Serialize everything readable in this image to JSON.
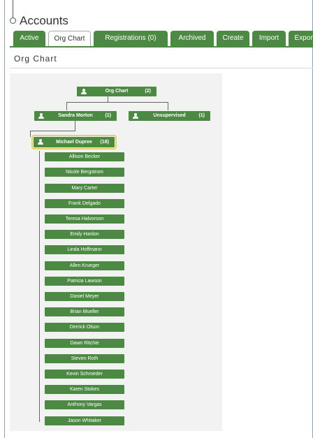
{
  "header": {
    "title": "Accounts"
  },
  "tabs": [
    {
      "label": "Active",
      "active": false
    },
    {
      "label": "Org Chart",
      "active": true
    },
    {
      "label": "Registrations (0)",
      "active": false
    },
    {
      "label": "Archived",
      "active": false
    },
    {
      "label": "Create",
      "active": false
    },
    {
      "label": "Import",
      "active": false
    },
    {
      "label": "Export",
      "active": false
    }
  ],
  "section": {
    "title": "Org Chart"
  },
  "org": {
    "root": {
      "name": "Org Chart",
      "count": "(2)"
    },
    "level1": [
      {
        "name": "Sandra Morton",
        "count": "(1)"
      },
      {
        "name": "Unsupervised",
        "count": "(1)"
      }
    ],
    "manager": {
      "name": "Michael Dupree",
      "count": "(18)"
    },
    "reports": [
      "Allison Becker",
      "Nicole Bergstrom",
      "Mary Carter",
      "Frank Delgado",
      "Teresa Halvorson",
      "Emily Hanlon",
      "Linda Hoffmann",
      "Allen Krueger",
      "Patricia Lawson",
      "Daniel Meyer",
      "Brian Mueller",
      "Derrick Olson",
      "Dawn Ritchie",
      "Steven Roth",
      "Kevin Schroeder",
      "Karen Stokes",
      "Anthony Vargas",
      "Jason Whitaker"
    ]
  },
  "colors": {
    "accent": "#4c8a44",
    "highlight": "#e6d25a",
    "frame": "#8aa4c8"
  },
  "icons": {
    "node": "user-icon"
  }
}
